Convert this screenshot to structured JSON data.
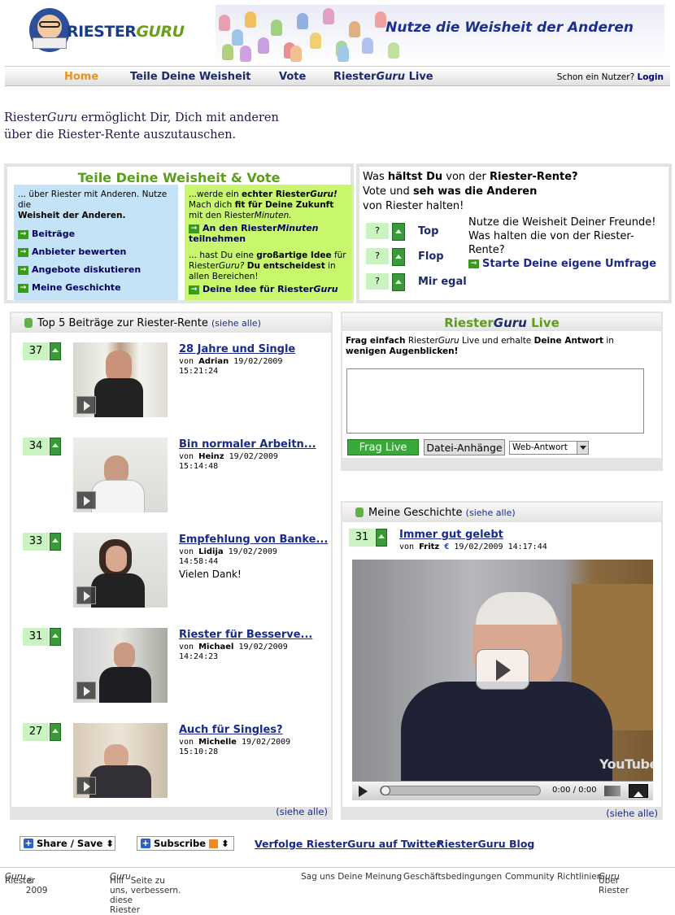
{
  "header": {
    "logo_text_a": "RIESTER",
    "logo_text_b": "GURU",
    "slogan": "Nutze die Weisheit der Anderen"
  },
  "nav": {
    "items": [
      "Home",
      "Teile Deine Weisheit",
      "Vote",
      "Riester",
      "Guru",
      "Live"
    ],
    "login_prompt": "Schon ein Nutzer?",
    "login_label": "Login"
  },
  "intro": {
    "brand_a": "Riester",
    "brand_b": "Guru",
    "line1": "ermöglicht Dir, Dich mit anderen",
    "line2": "über die Riester-Rente auszutauschen."
  },
  "teile": {
    "title": "Teile Deine Weisheit & Vote",
    "blue_intro_a": "... über Riester mit Anderen. Nutze die",
    "blue_intro_b": "Weisheit der Anderen.",
    "blue_links": [
      "Beiträge",
      "Anbieter bewerten",
      "Angebote diskutieren",
      "Meine Geschichte"
    ],
    "green_p1_a": "...werde ein",
    "green_p1_b": "echter Riester",
    "green_p1_c": "Guru!",
    "green_p1_d": "Mach dich",
    "green_p1_e": "fit für Deine Zukunft",
    "green_p1_f": "mit den Riester",
    "green_p1_g": "Minuten.",
    "green_link1_a": "An den Riester",
    "green_link1_b": "Minuten",
    "green_link1_c": "teilnehmen",
    "green_p2_a": "... hast Du eine",
    "green_p2_b": "großartige Idee",
    "green_p2_c": "für Riester",
    "green_p2_d": "Guru?",
    "green_p2_e": "Du entscheidest",
    "green_p2_f": "in allen Bereichen!",
    "green_link2_a": "Deine Idee für Riester",
    "green_link2_b": "Guru"
  },
  "vote": {
    "q_a": "Was",
    "q_b": "hältst Du",
    "q_c": "von der",
    "q_d": "Riester-Rente?",
    "q_e": "Vote und",
    "q_f": "seh was die Anderen",
    "q_g": "von Riester halten!",
    "rows": [
      {
        "value": "?",
        "label": "Top"
      },
      {
        "value": "?",
        "label": "Flop"
      },
      {
        "value": "?",
        "label": "Mir egal"
      }
    ],
    "friends_1": "Nutze die Weisheit Deiner Freunde!",
    "friends_2": "Was halten die von der Riester-Rente?",
    "friends_link": "Starte Deine eigene Umfrage"
  },
  "top5": {
    "title": "Top 5 Beiträge zur Riester-Rente",
    "see_all": "(siehe alle)",
    "items": [
      {
        "count": "37",
        "title": "28 Jahre und Single",
        "von": "von",
        "user": "Adrian",
        "date": "19/02/2009",
        "time": "15:21:24",
        "extra": ""
      },
      {
        "count": "34",
        "title": "Bin normaler Arbeitn...",
        "von": "von",
        "user": "Heinz",
        "date": "19/02/2009",
        "time": "15:14:48",
        "extra": ""
      },
      {
        "count": "33",
        "title": "Empfehlung von Banke...",
        "von": "von",
        "user": "Lidija",
        "date": "19/02/2009",
        "time": "14:58:44",
        "extra": "Vielen Dank!"
      },
      {
        "count": "31",
        "title": "Riester für Besserve...",
        "von": "von",
        "user": "Michael",
        "date": "19/02/2009",
        "time": "14:24:23",
        "extra": ""
      },
      {
        "count": "27",
        "title": "Auch für Singles?",
        "von": "von",
        "user": "Michelle",
        "date": "19/02/2009",
        "time": "15:10:28",
        "extra": ""
      }
    ],
    "footer_see_all": "(siehe alle)"
  },
  "live": {
    "title_a": "Riester",
    "title_b": "Guru",
    "title_c": "Live",
    "desc_a": "Frag einfach",
    "desc_b": "Riester",
    "desc_c": "Guru",
    "desc_d": "Live und erhalte",
    "desc_e": "Deine Antwort",
    "desc_f": "in",
    "desc_g": "wenigen Augenblicken!",
    "frag_label": "Frag Live",
    "datei_label": "Datei-Anhänge",
    "select_value": "Web-Antwort"
  },
  "meine": {
    "title": "Meine Geschichte",
    "see_all": "(siehe alle)",
    "count": "31",
    "video_title": "Immer gut gelebt",
    "von": "von",
    "user": "Fritz",
    "euro": "€",
    "datetime": "19/02/2009 14:17:44",
    "player_time": "0:00 / 0:00",
    "youtube": "YouTube",
    "footer_see_all": "(siehe alle)"
  },
  "footer": {
    "share_label": "Share / Save",
    "subscribe_label": "Subscribe",
    "twitter": "Verfolge RiesterGuru auf Twitter",
    "blog": "RiesterGuru Blog",
    "copy_a": "Riester",
    "copy_b": "Guru",
    "copy_c": "® 2009",
    "help_a": "Hilf uns, diese Riester",
    "help_b": "Guru",
    "help_c": "Seite zu verbessern.",
    "meinung": "Sag uns Deine Meinung",
    "agb": "Geschäftsbedingungen",
    "richtlinien": "Community Richtlinien",
    "ueber_a": "Über Riester",
    "ueber_b": "Guru"
  }
}
